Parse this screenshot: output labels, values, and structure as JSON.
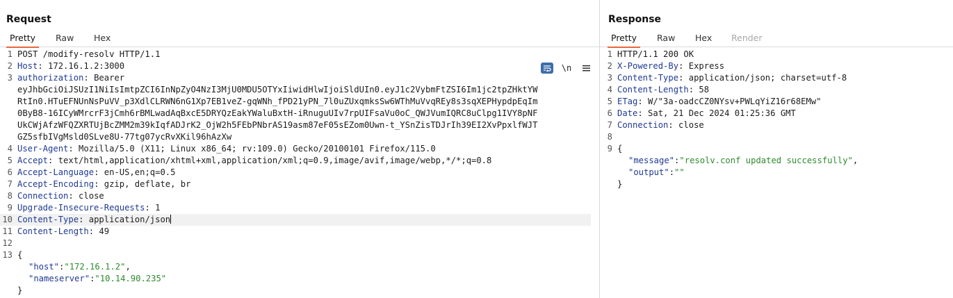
{
  "request": {
    "title": "Request",
    "tabs": [
      "Pretty",
      "Raw",
      "Hex"
    ],
    "active_tab": "Pretty",
    "toolbar": {
      "wrap_icon": "wrap-lines-icon",
      "newline_label": "\\n",
      "menu_icon": "hamburger-menu-icon"
    },
    "lines": {
      "l1": {
        "n": "1",
        "text": "POST /modify-resolv HTTP/1.1"
      },
      "l2": {
        "n": "2",
        "k": "Host",
        "v": " 172.16.1.2:3000"
      },
      "l3": {
        "n": "3",
        "k": "authorization",
        "v": " Bearer"
      },
      "l3a": "eyJhbGciOiJSUzI1NiIsImtpZCI6InNpZyO4NzI3MjU0MDU5OTYxIiwidHlwIjoiSldUIn0.eyJ1c2VybmFtZSI6Im1jc2tpZHktYW",
      "l3b": "RtIn0.HTuEFNUnNsPuVV_p3XdlCLRWN6nG1Xp7EB1veZ-gqWNh_fPD21yPN_7l0uZUxqmksSw6WThMuVvqREy8s3sqXEPHypdpEqIm",
      "l3c": "0ByB8-16ICyWMrcrF3jCmh6rBMLwadAqBxcE5DRYQzEakYWaluBxtH-iRnuguUIv7rpUIFsaVu0oC_QWJVumIQRC8uClpg1IVY8pNF",
      "l3d": "UkCWjAfzWFQZXRTUjBcZMM2m39kIqfADJrK2_OjW2h5FEbPNbrAS19asm87eF05sEZom0Uwn-t_YSnZisTDJrIh39EI2XvPpxlfWJT",
      "l3e": "GZ5sfbIVgMsld0SLve8U-77tg07ycRvXKil96hAzXw",
      "l4": {
        "n": "4",
        "k": "User-Agent",
        "v": " Mozilla/5.0 (X11; Linux x86_64; rv:109.0) Gecko/20100101 Firefox/115.0"
      },
      "l5": {
        "n": "5",
        "k": "Accept",
        "v": " text/html,application/xhtml+xml,application/xml;q=0.9,image/avif,image/webp,*/*;q=0.8"
      },
      "l6": {
        "n": "6",
        "k": "Accept-Language",
        "v": " en-US,en;q=0.5"
      },
      "l7": {
        "n": "7",
        "k": "Accept-Encoding",
        "v": " gzip, deflate, br"
      },
      "l8": {
        "n": "8",
        "k": "Connection",
        "v": " close"
      },
      "l9": {
        "n": "9",
        "k": "Upgrade-Insecure-Requests",
        "v": " 1"
      },
      "l10": {
        "n": "10",
        "k": "Content-Type",
        "v": " application/json"
      },
      "l11": {
        "n": "11",
        "k": "Content-Length",
        "v": " 49"
      },
      "l12": {
        "n": "12"
      },
      "l13": {
        "n": "13",
        "text": "{"
      },
      "body_host_key": "\"host\"",
      "body_host_val": "\"172.16.1.2\"",
      "body_ns_key": "\"nameserver\"",
      "body_ns_val": "\"10.14.90.235\"",
      "body_close": "}"
    }
  },
  "response": {
    "title": "Response",
    "tabs": [
      "Pretty",
      "Raw",
      "Hex",
      "Render"
    ],
    "active_tab": "Pretty",
    "lines": {
      "l1": {
        "n": "1",
        "text": "HTTP/1.1 200 OK"
      },
      "l2": {
        "n": "2",
        "k": "X-Powered-By",
        "v": " Express"
      },
      "l3": {
        "n": "3",
        "k": "Content-Type",
        "v": " application/json; charset=utf-8"
      },
      "l4": {
        "n": "4",
        "k": "Content-Length",
        "v": " 58"
      },
      "l5": {
        "n": "5",
        "k": "ETag",
        "v": " W/\"3a-oadcCZ0NYsv+PWLqYiZ16r68EMw\""
      },
      "l6": {
        "n": "6",
        "k": "Date",
        "v": " Sat, 21 Dec 2024 01:25:36 GMT"
      },
      "l7": {
        "n": "7",
        "k": "Connection",
        "v": " close"
      },
      "l8": {
        "n": "8"
      },
      "l9": {
        "n": "9",
        "text": "{"
      },
      "body_msg_key": "\"message\"",
      "body_msg_val": "\"resolv.conf updated successfully\"",
      "body_out_key": "\"output\"",
      "body_out_val": "\"\"",
      "body_close": "}"
    }
  },
  "colors": {
    "accent_tab": "#e8663b",
    "header_key": "#1f3a93",
    "json_string": "#2e8b2e",
    "toolbar_active": "#3d6ea8"
  }
}
